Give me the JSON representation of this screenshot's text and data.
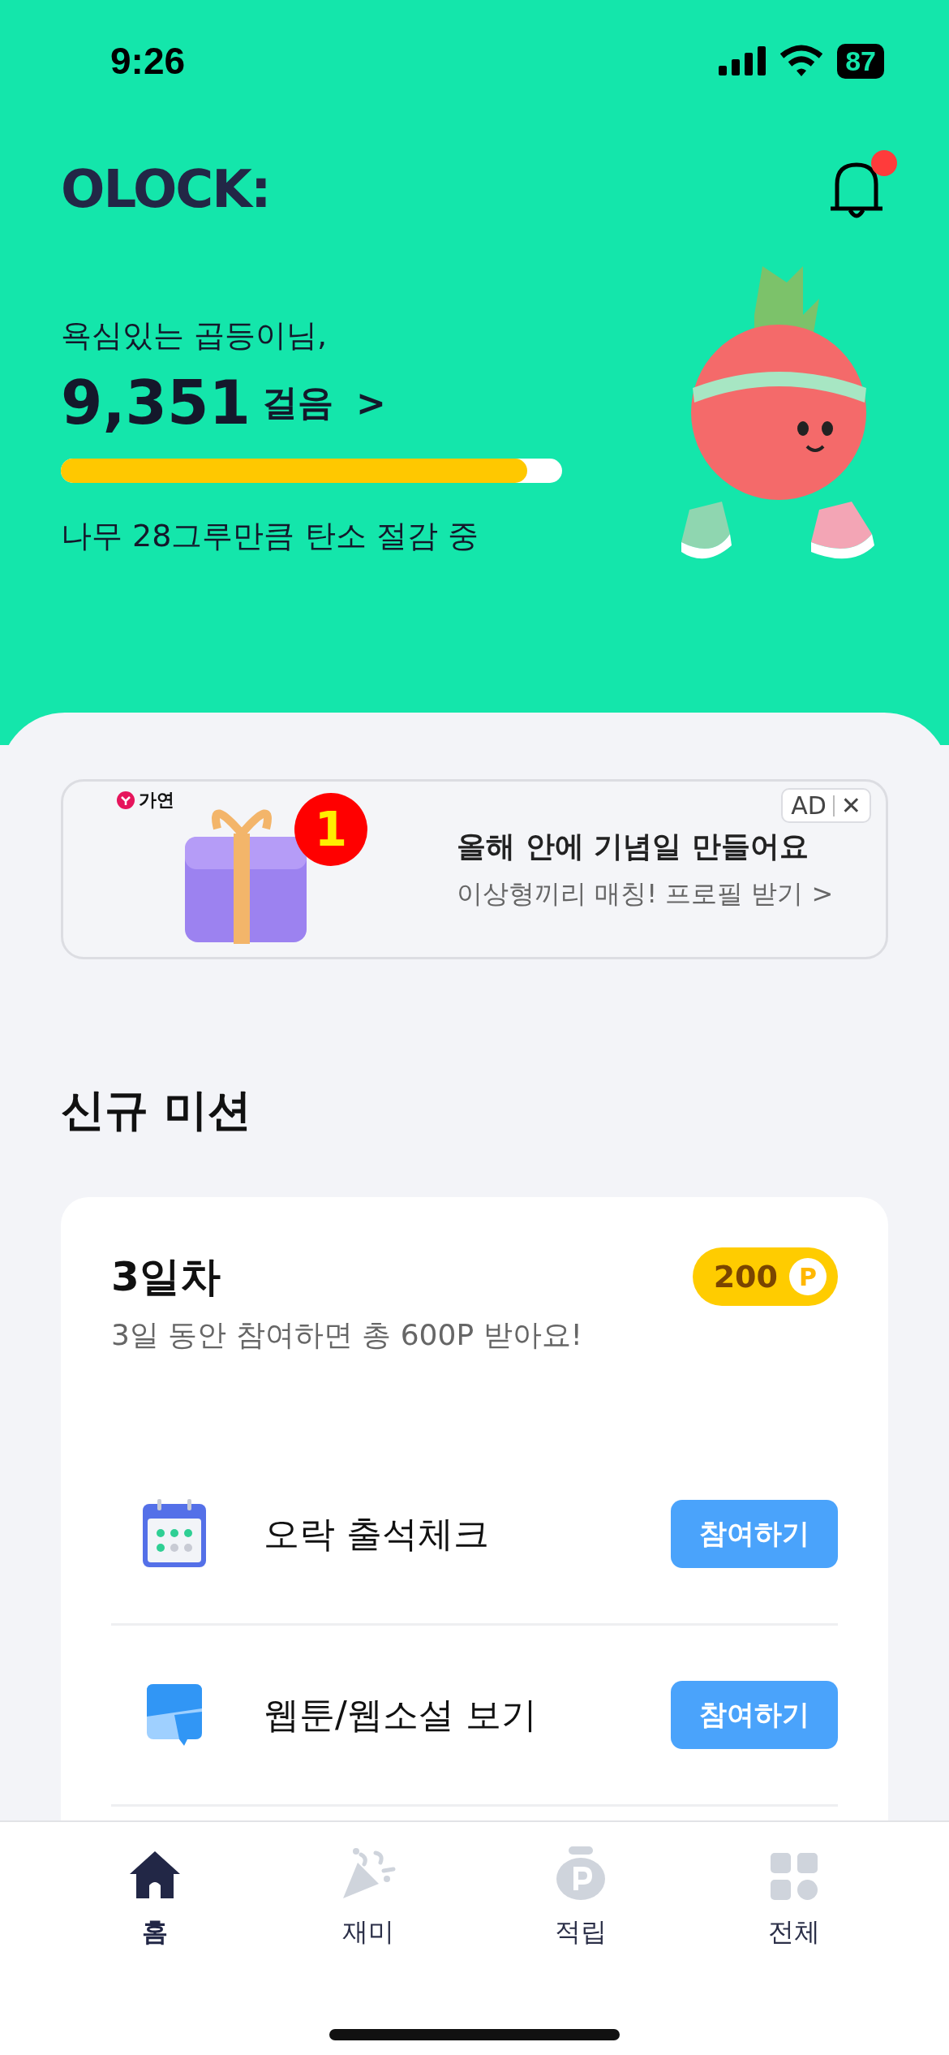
{
  "status_bar": {
    "time": "9:26",
    "battery": "87"
  },
  "header": {
    "logo": "OLOCK:",
    "notification_dot": true
  },
  "summary": {
    "greeting": "욕심있는 곱등이님,",
    "steps": "9,351",
    "steps_unit": "걸음",
    "chevron": ">",
    "progress": {
      "level": 0.93
    },
    "carbon_text": "나무 28그루만큼 탄소 절감 중"
  },
  "ad": {
    "brand": "가연",
    "badge": "1",
    "label": "AD",
    "close": "✕",
    "title": "올해 안에 기념일 만들어요",
    "subtitle": "이상형끼리 매칭! 프로필 받기 >"
  },
  "section_title": "신규 미션",
  "mission": {
    "title": "3일차",
    "points": "200",
    "points_unit": "P",
    "subtitle": "3일 동안 참여하면 총 600P 받아요!",
    "rows": [
      {
        "kind": "calendar",
        "label": "오락 출석체크",
        "button": "참여하기"
      },
      {
        "kind": "webtoon",
        "label": "웹툰/웹소설 보기",
        "button": "참여하기"
      }
    ]
  },
  "tab_bar": [
    {
      "kind": "home",
      "label": "홈",
      "selected": true
    },
    {
      "kind": "fun",
      "label": "재미",
      "selected": false
    },
    {
      "kind": "points",
      "label": "적립",
      "selected": false
    },
    {
      "kind": "all",
      "label": "전체",
      "selected": false
    }
  ]
}
